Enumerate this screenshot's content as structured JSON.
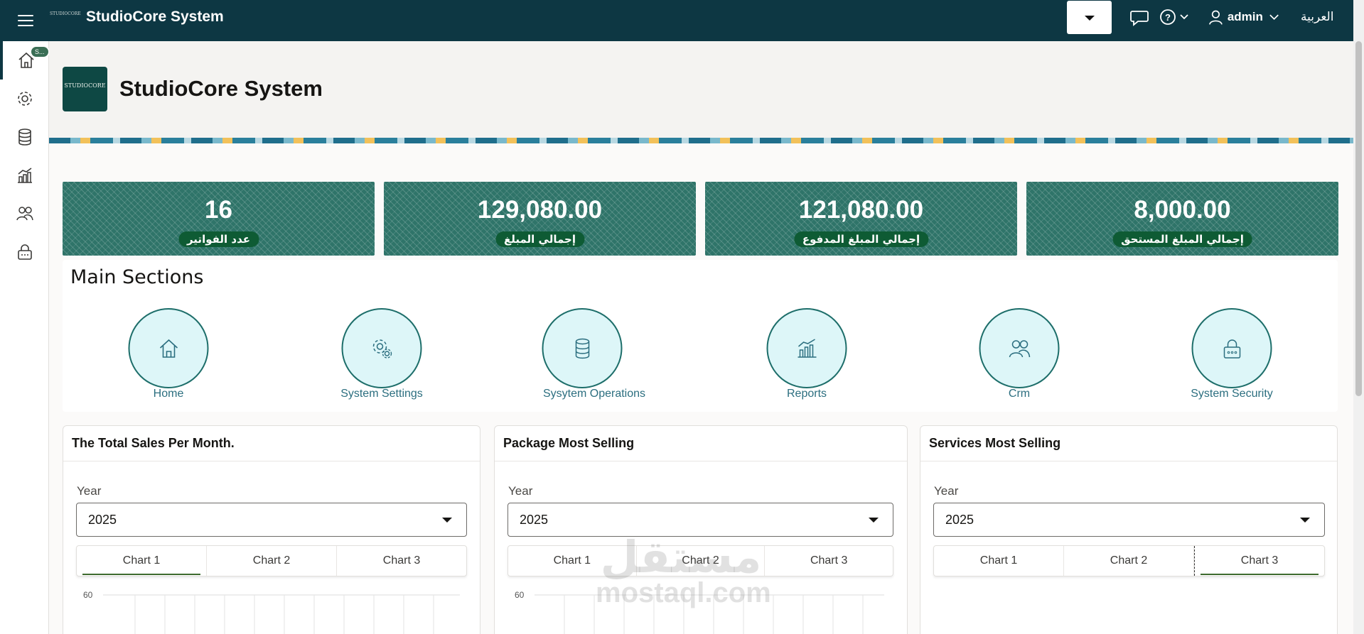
{
  "header": {
    "app_title": "StudioCore System",
    "logo_text": "STUDIOCORE",
    "user_name": "admin",
    "language": "العربية"
  },
  "sidebar": {
    "home_badge": "S..."
  },
  "page": {
    "title": "StudioCore System",
    "logo_text": "STUDIOCORE"
  },
  "stats": [
    {
      "value": "16",
      "label": "عدد الفواتير"
    },
    {
      "value": "129,080.00",
      "label": "إجمالي المبلغ"
    },
    {
      "value": "121,080.00",
      "label": "إجمالي المبلغ المدفوع"
    },
    {
      "value": "8,000.00",
      "label": "إجمالي المبلغ المستحق"
    }
  ],
  "sections": {
    "title": "Main Sections",
    "items": [
      {
        "label": "Home",
        "icon": "home-icon"
      },
      {
        "label": "System Settings",
        "icon": "gear-icon"
      },
      {
        "label": "Sysytem Operations",
        "icon": "database-icon"
      },
      {
        "label": "Reports",
        "icon": "chart-icon"
      },
      {
        "label": "Crm",
        "icon": "users-icon"
      },
      {
        "label": "System Security",
        "icon": "lock-icon"
      }
    ]
  },
  "panels": [
    {
      "title": "The Total Sales Per Month.",
      "year_label": "Year",
      "year_value": "2025",
      "tabs": [
        "Chart 1",
        "Chart 2",
        "Chart 3"
      ],
      "selected_tab": 0,
      "axis_top": "60"
    },
    {
      "title": "Package Most Selling",
      "year_label": "Year",
      "year_value": "2025",
      "tabs": [
        "Chart 1",
        "Chart 2",
        "Chart 3"
      ],
      "selected_tab": -1,
      "axis_top": "60"
    },
    {
      "title": "Services Most Selling",
      "year_label": "Year",
      "year_value": "2025",
      "tabs": [
        "Chart 1",
        "Chart 2",
        "Chart 3"
      ],
      "selected_tab": 2,
      "axis_top": ""
    }
  ],
  "watermark": {
    "line1": "مستقل",
    "line2": "mostaql.com"
  },
  "colors": {
    "header_bg": "#0d3743",
    "accent": "#1d6e6a",
    "circle_fill": "#ddf6f8",
    "label_pill": "#0e5b34"
  }
}
